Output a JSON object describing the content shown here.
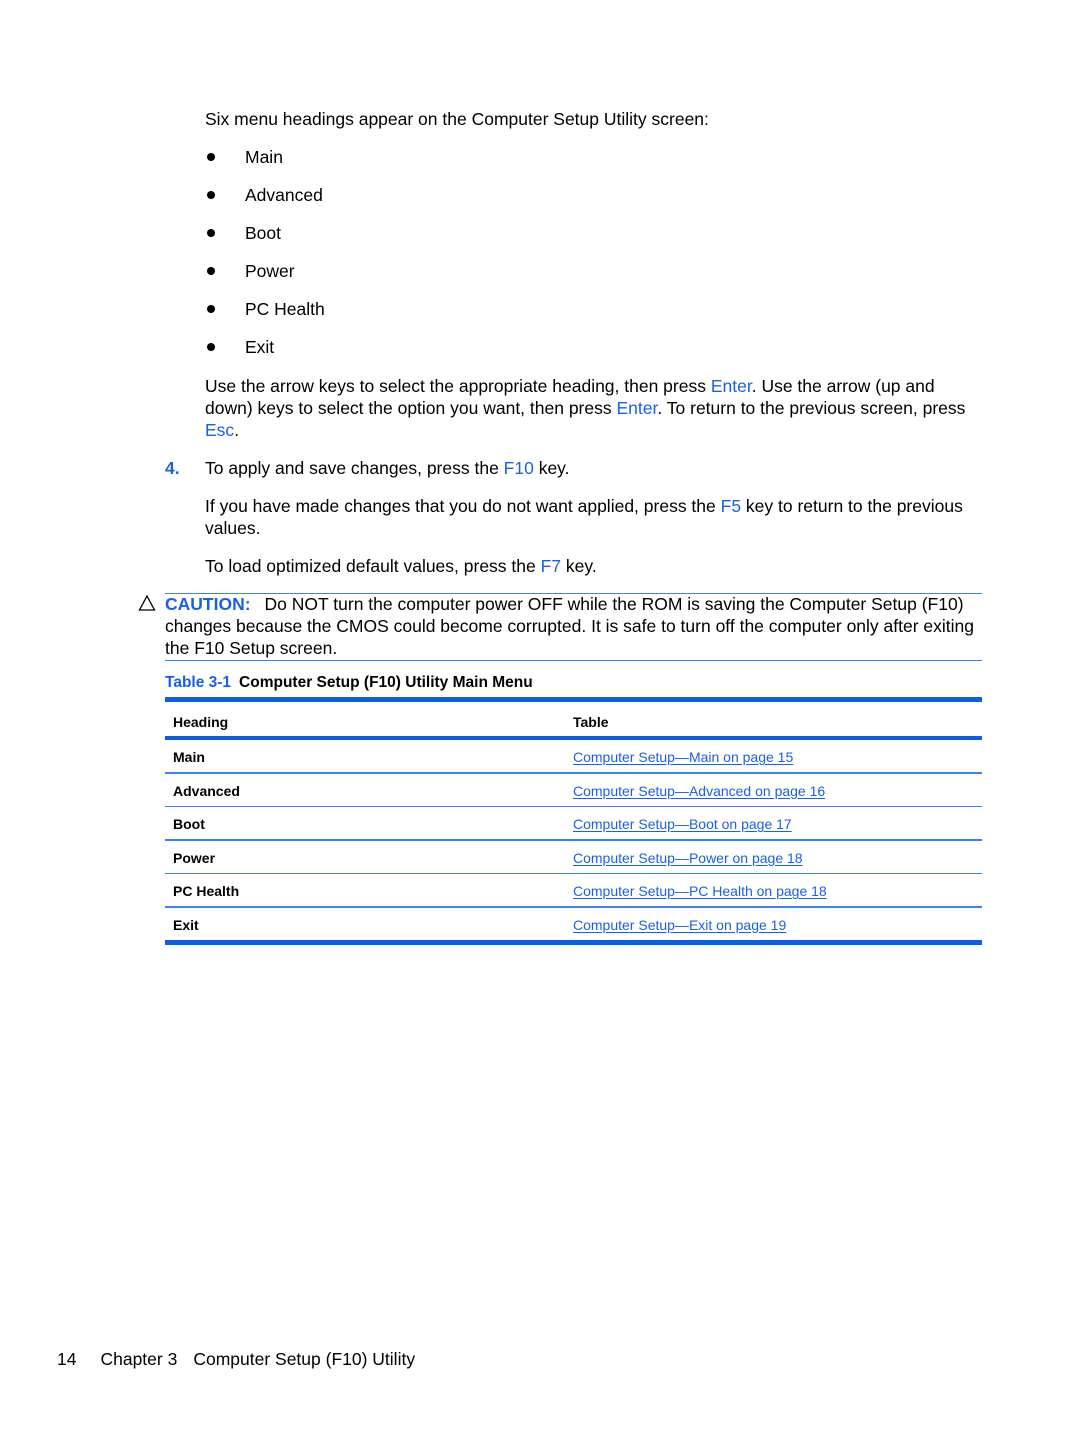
{
  "intro": "Six menu headings appear on the Computer Setup Utility screen:",
  "bullets": [
    "Main",
    "Advanced",
    "Boot",
    "Power",
    "PC Health",
    "Exit"
  ],
  "arrows_paragraph": {
    "p1": "Use the arrow keys to select the appropriate heading, then press ",
    "k1": "Enter",
    "p2": ". Use the arrow (up and down) keys to select the option you want, then press ",
    "k2": "Enter",
    "p3": ". To return to the previous screen, press ",
    "k3": "Esc",
    "p4": "."
  },
  "step4": {
    "number": "4.",
    "p1": "To apply and save changes, press the ",
    "key": "F10",
    "p2": " key."
  },
  "f5_paragraph": {
    "p1": "If you have made changes that you do not want applied, press the ",
    "key": "F5",
    "p2": " key to return to the previous values."
  },
  "f7_paragraph": {
    "p1": "To load optimized default values, press the ",
    "key": "F7",
    "p2": " key."
  },
  "caution": {
    "icon": "warning-triangle-icon",
    "label": "CAUTION:",
    "text": "Do NOT turn the computer power OFF while the ROM is saving the Computer Setup (F10) changes because the CMOS could become corrupted. It is safe to turn off the computer only after exiting the F10 Setup screen."
  },
  "table": {
    "caption_number": "Table 3-1",
    "caption_title": "Computer Setup (F10) Utility Main Menu",
    "headers": [
      "Heading",
      "Table"
    ],
    "rows": [
      {
        "heading": "Main",
        "link": "Computer Setup—Main on page 15"
      },
      {
        "heading": "Advanced",
        "link": "Computer Setup—Advanced on page 16"
      },
      {
        "heading": "Boot",
        "link": "Computer Setup—Boot on page 17"
      },
      {
        "heading": "Power",
        "link": "Computer Setup—Power on page 18"
      },
      {
        "heading": "PC Health",
        "link": "Computer Setup—PC Health on page 18"
      },
      {
        "heading": "Exit",
        "link": "Computer Setup—Exit on page 19"
      }
    ]
  },
  "footer": {
    "page_number": "14",
    "chapter": "Chapter 3",
    "chapter_title": "Computer Setup (F10) Utility"
  },
  "colors": {
    "accent_blue": "#1a5fe8",
    "rule_blue": "#0a5fe8"
  }
}
